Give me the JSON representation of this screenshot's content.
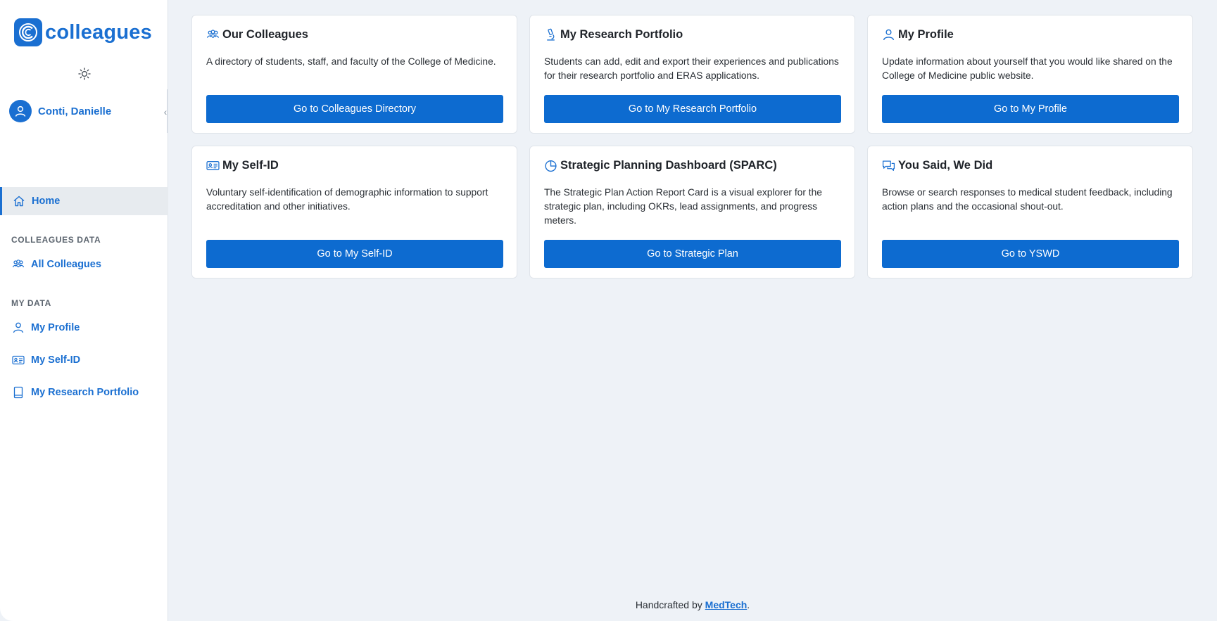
{
  "app": {
    "logo_text": "colleagues",
    "logo_letter": "C"
  },
  "user": {
    "name": "Conti, Danielle"
  },
  "sidebar": {
    "home_label": "Home",
    "section_colleagues": "COLLEAGUES DATA",
    "all_colleagues_label": "All Colleagues",
    "section_my_data": "MY DATA",
    "my_profile_label": "My Profile",
    "my_self_id_label": "My Self-ID",
    "my_research_portfolio_label": "My Research Portfolio"
  },
  "cards": [
    {
      "title": "Our Colleagues",
      "icon": "people-icon",
      "description": "A directory of students, staff, and faculty of the College of Medicine.",
      "button": "Go to Colleagues Directory"
    },
    {
      "title": "My Research Portfolio",
      "icon": "microscope-icon",
      "description": "Students can add, edit and export their experiences and publications for their research portfolio and ERAS applications.",
      "button": "Go to My Research Portfolio"
    },
    {
      "title": "My Profile",
      "icon": "person-icon",
      "description": "Update information about yourself that you would like shared on the College of Medicine public website.",
      "button": "Go to My Profile"
    },
    {
      "title": "My Self-ID",
      "icon": "id-card-icon",
      "description": "Voluntary self-identification of demographic information to support accreditation and other initiatives.",
      "button": "Go to My Self-ID"
    },
    {
      "title": "Strategic Planning Dashboard (SPARC)",
      "icon": "pie-chart-icon",
      "description": "The Strategic Plan Action Report Card is a visual explorer for the strategic plan, including OKRs, lead assignments, and progress meters.",
      "button": "Go to Strategic Plan"
    },
    {
      "title": "You Said, We Did",
      "icon": "chat-icon",
      "description": "Browse or search responses to medical student feedback, including action plans and the occasional shout-out.",
      "button": "Go to YSWD"
    }
  ],
  "footer": {
    "prefix": "Handcrafted by ",
    "link": "MedTech",
    "suffix": "."
  },
  "colors": {
    "accent": "#1a6fd1",
    "button": "#0d6bd0",
    "background": "#eef2f7"
  }
}
